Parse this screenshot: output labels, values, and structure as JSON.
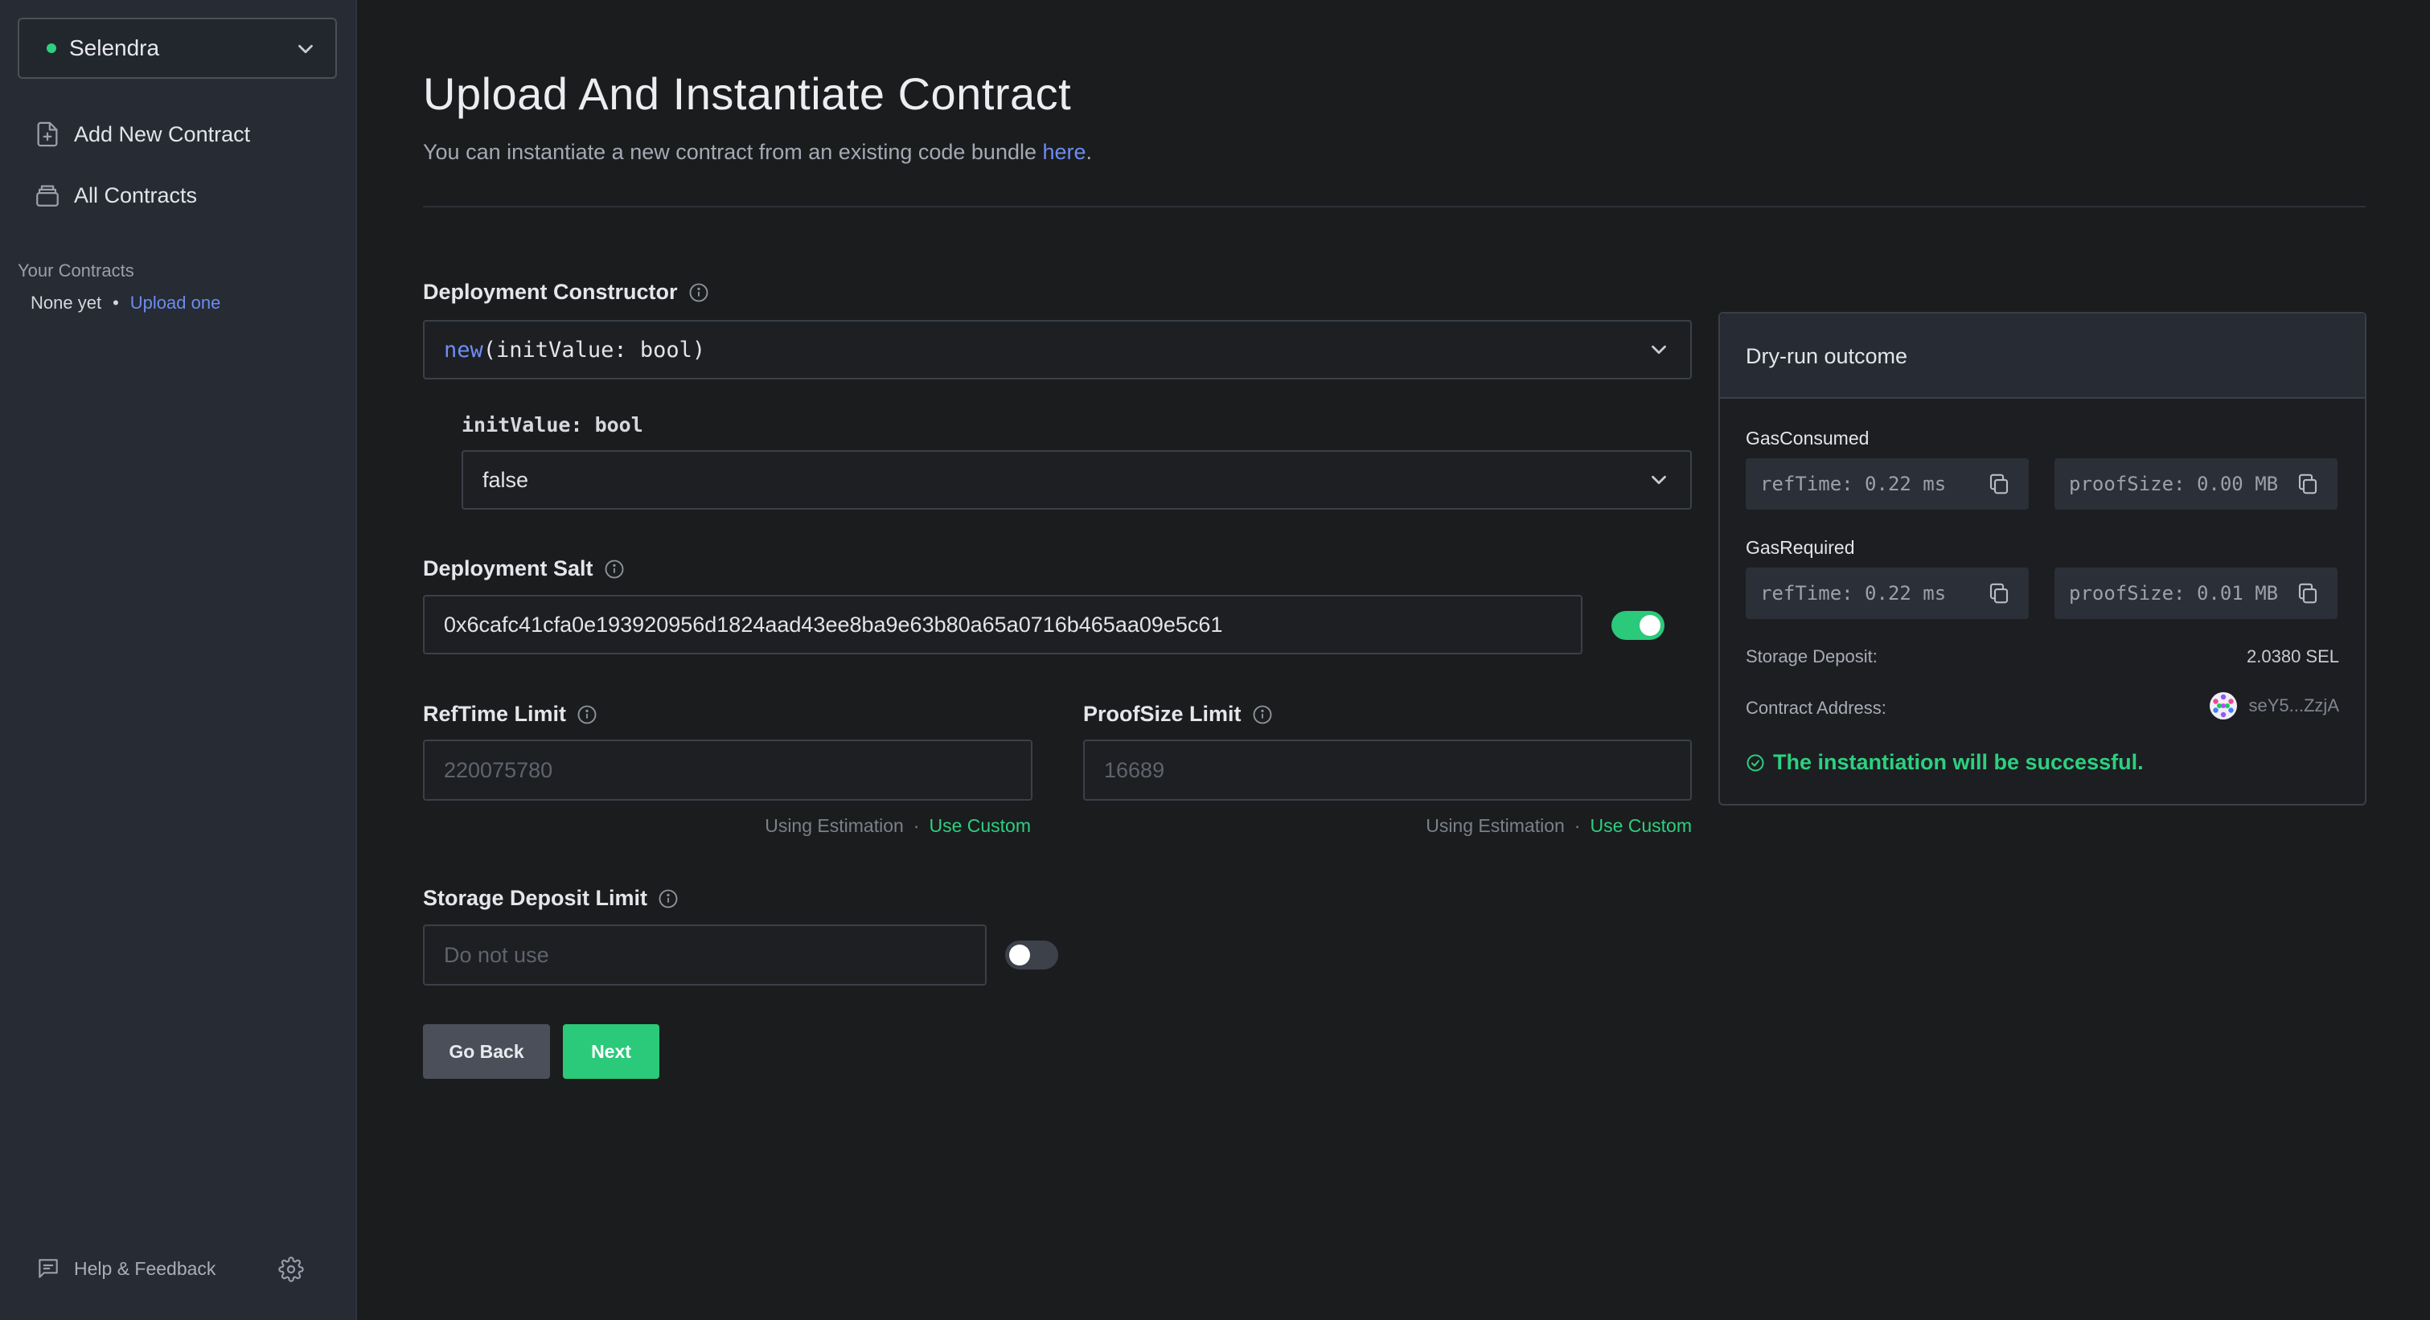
{
  "sidebar": {
    "chain": {
      "name": "Selendra",
      "status_color": "#2dd07f"
    },
    "nav": [
      {
        "label": "Add New Contract",
        "icon": "file-plus-icon"
      },
      {
        "label": "All Contracts",
        "icon": "archive-icon"
      }
    ],
    "your_contracts": {
      "heading": "Your Contracts",
      "empty_text": "None yet",
      "separator": "•",
      "upload_link": "Upload one"
    },
    "footer": {
      "help_label": "Help & Feedback",
      "settings_icon": "gear-icon"
    }
  },
  "page": {
    "title": "Upload And Instantiate Contract",
    "subtitle": "You can instantiate a new contract from an existing code bundle ",
    "subtitle_link": "here",
    "subtitle_end": "."
  },
  "form": {
    "constructor": {
      "label": "Deployment Constructor",
      "value_keyword": "new",
      "value_rest": "(initValue: bool)",
      "param_label": "initValue: bool",
      "param_value": "false"
    },
    "salt": {
      "label": "Deployment Salt",
      "value": "0x6cafc41cfa0e193920956d1824aad43ee8ba9e63b80a65a0716b465aa09e5c61",
      "enabled": true
    },
    "reftime": {
      "label": "RefTime Limit",
      "placeholder": "220075780",
      "estimate_text": "Using Estimation",
      "sep": "·",
      "custom_link": "Use Custom"
    },
    "proofsize": {
      "label": "ProofSize Limit",
      "placeholder": "16689",
      "estimate_text": "Using Estimation",
      "sep": "·",
      "custom_link": "Use Custom"
    },
    "storage": {
      "label": "Storage Deposit Limit",
      "placeholder": "Do not use",
      "enabled": false
    },
    "buttons": {
      "back": "Go Back",
      "next": "Next"
    }
  },
  "dry_run": {
    "title": "Dry-run outcome",
    "gas_consumed": {
      "label": "GasConsumed",
      "ref_time": "refTime: 0.22 ms",
      "proof_size": "proofSize: 0.00 MB"
    },
    "gas_required": {
      "label": "GasRequired",
      "ref_time": "refTime: 0.22 ms",
      "proof_size": "proofSize: 0.01 MB"
    },
    "storage_deposit": {
      "label": "Storage Deposit:",
      "value": "2.0380 SEL"
    },
    "contract_address": {
      "label": "Contract Address:",
      "value": "seY5...ZzjA"
    },
    "result": "The instantiation will be successful."
  },
  "colors": {
    "accent_green": "#2bc97a",
    "link_blue": "#6c8cf0",
    "background": "#1b1c1e",
    "sidebar": "#262b34"
  }
}
